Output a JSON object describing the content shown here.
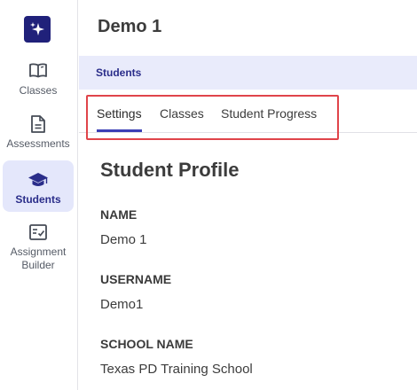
{
  "nav": {
    "items": [
      {
        "label": "Classes",
        "icon": "book-open-icon",
        "active": false
      },
      {
        "label": "Assessments",
        "icon": "document-icon",
        "active": false
      },
      {
        "label": "Students",
        "icon": "graduation-cap-icon",
        "active": true
      },
      {
        "label": "Assignment Builder",
        "icon": "checklist-icon",
        "active": false
      }
    ]
  },
  "header": {
    "title": "Demo 1",
    "breadcrumb": "Students"
  },
  "tabs": [
    {
      "label": "Settings",
      "active": true
    },
    {
      "label": "Classes",
      "active": false
    },
    {
      "label": "Student Progress",
      "active": false
    }
  ],
  "profile": {
    "title": "Student Profile",
    "fields": [
      {
        "label": "NAME",
        "value": "Demo 1"
      },
      {
        "label": "USERNAME",
        "value": "Demo1"
      },
      {
        "label": "SCHOOL NAME",
        "value": "Texas PD Training School"
      }
    ]
  },
  "colors": {
    "brand": "#20217a",
    "accent": "#3b3fb6",
    "active_bg": "#e4e7fb",
    "highlight": "#e0444a"
  }
}
